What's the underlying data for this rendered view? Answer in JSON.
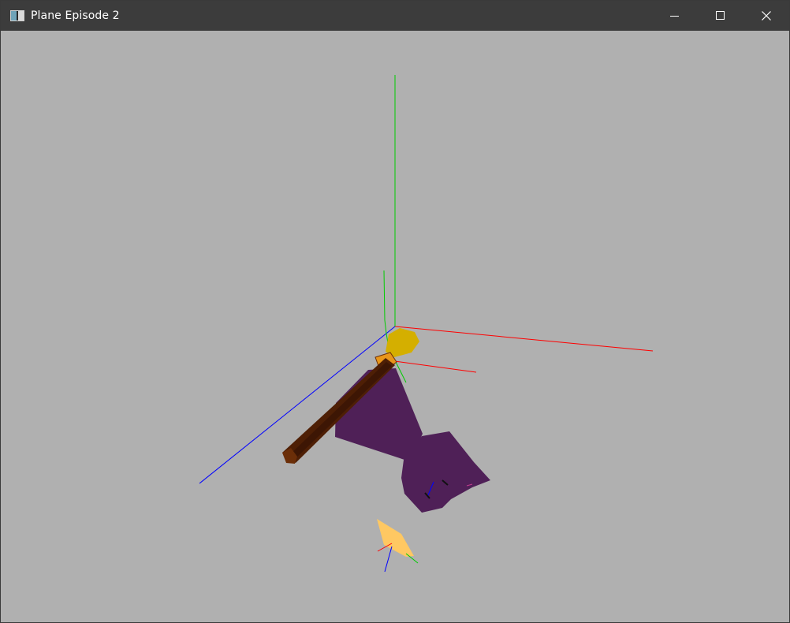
{
  "window": {
    "title": "Plane Episode 2",
    "controls": {
      "minimize": "minimize",
      "maximize": "maximize",
      "close": "close"
    }
  },
  "scene": {
    "background": "#b0b0b0",
    "colors": {
      "axis_x": "#ff0000",
      "axis_y": "#00cc00",
      "axis_z": "#0000ff",
      "rod": "#4e1f05",
      "rod_end": "#6b2e08",
      "plane_body": "#4f2057",
      "tail_fin": "#d4af00",
      "hinge": "#e8961a",
      "target_marker": "#ffc862"
    }
  }
}
